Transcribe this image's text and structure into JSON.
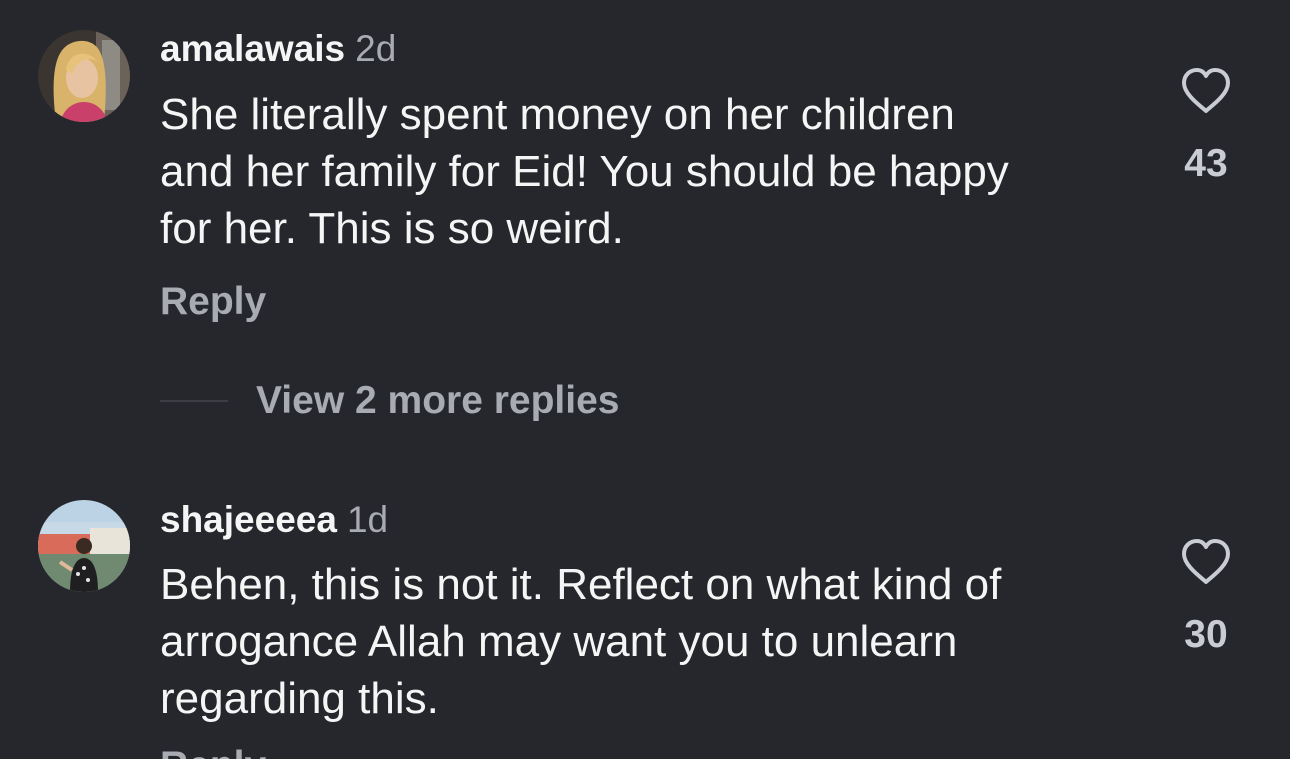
{
  "comments": [
    {
      "username": "amalawais",
      "time": "2d",
      "lines": [
        "She literally spent money on her children",
        "and her family for Eid! You should be happy",
        "for her. This is so weird."
      ],
      "likes": "43",
      "reply_label": "Reply",
      "view_more": "View 2 more replies"
    },
    {
      "username": "shajeeeea",
      "time": "1d",
      "lines": [
        "Behen, this is not it. Reflect on what kind of",
        "arrogance Allah may want you to unlearn",
        "regarding this."
      ],
      "likes": "30",
      "reply_label": "Reply"
    }
  ],
  "icons": {
    "like": "heart-outline-icon"
  },
  "colors": {
    "background": "#25272c",
    "text_primary": "#f5f5f5",
    "text_secondary": "#a8abb2"
  }
}
